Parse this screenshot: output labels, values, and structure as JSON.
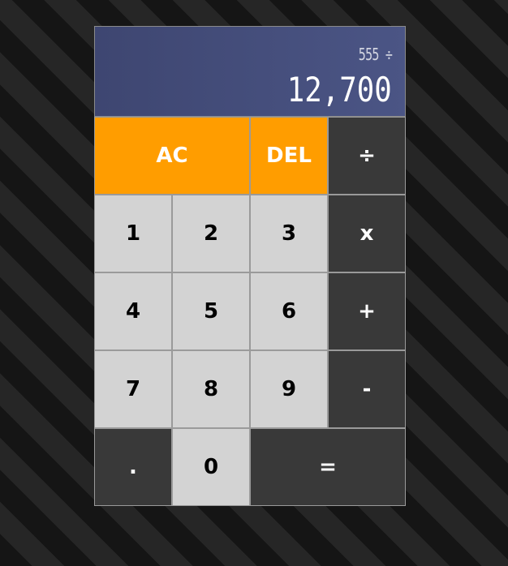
{
  "display": {
    "previous": "555 ÷",
    "current": "12,700"
  },
  "keys": {
    "ac": "AC",
    "del": "DEL",
    "divide": "÷",
    "one": "1",
    "two": "2",
    "three": "3",
    "multiply": "x",
    "four": "4",
    "five": "5",
    "six": "6",
    "plus": "+",
    "seven": "7",
    "eight": "8",
    "nine": "9",
    "minus": "-",
    "decimal": ".",
    "zero": "0",
    "equals": "="
  },
  "colors": {
    "accent": "#ff9d00",
    "display": "#434c7a",
    "number_key": "#d3d3d3",
    "operator_key": "#393939"
  }
}
